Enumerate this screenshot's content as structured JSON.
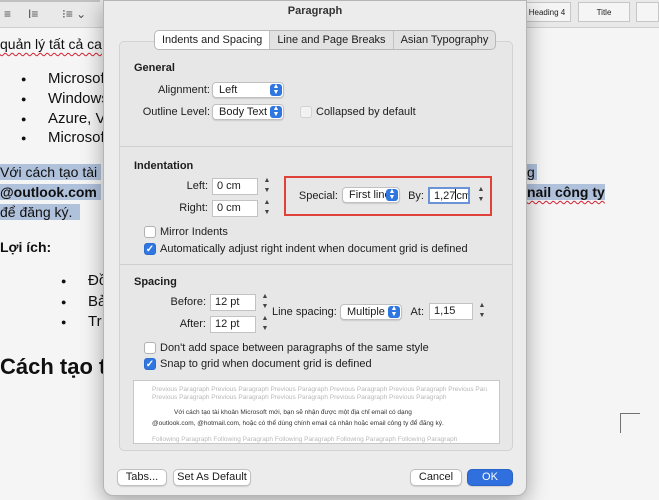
{
  "background_doc": {
    "ribbon": {
      "styles": [
        "Heading 4",
        "Title"
      ],
      "tools": [
        "≡",
        "I≡",
        "⁝≡ ⌄"
      ]
    },
    "lines": {
      "intro": "quản lý tất cả ca",
      "bullets_1": [
        "Microsof",
        "Windows",
        "Azure, V",
        "Microsof"
      ],
      "para_1": "Với cách tạo tài",
      "para_2": "@outlook.com",
      "para_3": "để đăng ký.",
      "para_right_1": "g",
      "para_right_2": "nail công ty",
      "benefits": "Lợi ích:",
      "bullets_2": [
        "Đồ",
        "Bả",
        "Tr"
      ],
      "heading": "Cách tạo t"
    }
  },
  "dialog": {
    "title": "Paragraph",
    "tabs": [
      "Indents and Spacing",
      "Line and Page Breaks",
      "Asian Typography"
    ],
    "general": {
      "title": "General",
      "alignment_label": "Alignment:",
      "alignment_value": "Left",
      "outline_label": "Outline Level:",
      "outline_value": "Body Text",
      "collapsed_label": "Collapsed by default"
    },
    "indentation": {
      "title": "Indentation",
      "left_label": "Left:",
      "left_value": "0 cm",
      "right_label": "Right:",
      "right_value": "0 cm",
      "special_label": "Special:",
      "special_value": "First line",
      "by_label": "By:",
      "by_value_a": "1,27",
      "by_value_b": "cm",
      "mirror_label": "Mirror Indents",
      "auto_label": "Automatically adjust right indent when document grid is defined"
    },
    "spacing": {
      "title": "Spacing",
      "before_label": "Before:",
      "before_value": "12 pt",
      "after_label": "After:",
      "after_value": "12 pt",
      "line_spacing_label": "Line spacing:",
      "line_spacing_value": "Multiple",
      "at_label": "At:",
      "at_value": "1,15",
      "dont_add_label": "Don't add space between paragraphs of the same style",
      "snap_label": "Snap to grid when document grid is defined"
    },
    "preview": {
      "prev_1": "Previous Paragraph Previous Paragraph Previous Paragraph Previous Paragraph Previous Paragraph Previous Paragraph",
      "prev_2": "Previous Paragraph Previous Paragraph Previous Paragraph Previous Paragraph Previous Paragraph",
      "body_1": "Với cách tạo tài khoản Microsoft mới, bạn sẽ nhận được một địa chỉ email có dạng",
      "body_2": "@outlook.com, @hotmail.com, hoặc có thể dùng chính email cá nhân hoặc email công ty để đăng ký.",
      "next_1": "Following Paragraph Following Paragraph Following Paragraph Following Paragraph Following Paragraph"
    },
    "buttons": {
      "tabs": "Tabs...",
      "set_default": "Set As Default",
      "cancel": "Cancel",
      "ok": "OK"
    }
  },
  "colors": {
    "accent": "#2f76e0",
    "highlight_border": "#e0413a",
    "selection": "#b8c9e4"
  }
}
